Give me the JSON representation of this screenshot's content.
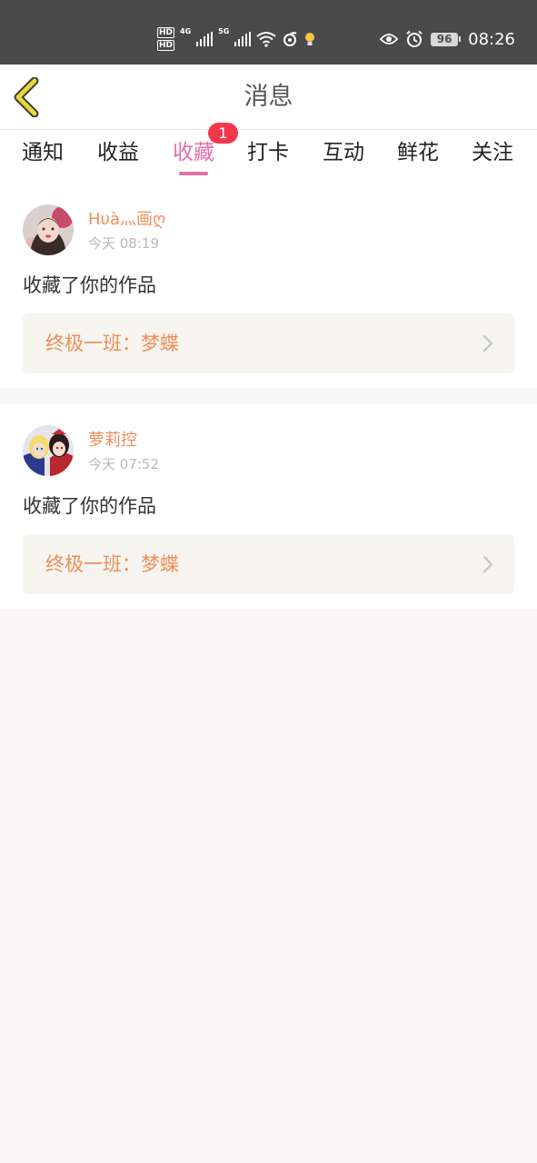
{
  "status_bar": {
    "hd1": "HD",
    "hd2": "HD",
    "net1": "4G",
    "net2": "5G",
    "battery": "96",
    "time": "08:26",
    "icons": [
      "hd-icon",
      "signal-icon",
      "wifi-icon",
      "sync-icon",
      "bulb-icon",
      "eye-icon",
      "alarm-icon",
      "battery-icon"
    ]
  },
  "header": {
    "title": "消息",
    "back_icon": "chevron-left-icon",
    "accent_color": "#e6d83a"
  },
  "tabs": [
    {
      "label": "通知",
      "active": false
    },
    {
      "label": "收益",
      "active": false
    },
    {
      "label": "收藏",
      "active": true,
      "badge": "1"
    },
    {
      "label": "打卡",
      "active": false
    },
    {
      "label": "互动",
      "active": false
    },
    {
      "label": "鲜花",
      "active": false
    },
    {
      "label": "关注",
      "active": false
    }
  ],
  "colors": {
    "active_tab": "#e66fa9",
    "badge": "#f2394b",
    "username": "#ef8f5a",
    "work_title": "#ef8f5a"
  },
  "messages": [
    {
      "username": "Hυà灬画ღ",
      "time": "今天 08:19",
      "action": "收藏了你的作品",
      "work": "终极一班：梦蝶"
    },
    {
      "username": "萝莉控",
      "time": "今天 07:52",
      "action": "收藏了你的作品",
      "work": "终极一班：梦蝶"
    }
  ]
}
